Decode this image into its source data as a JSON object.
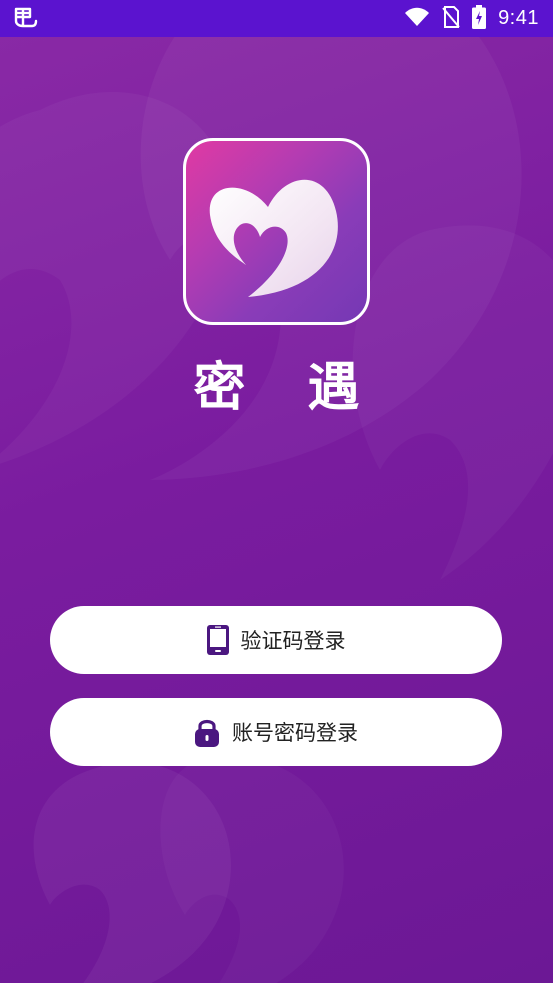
{
  "status_bar": {
    "time": "9:41",
    "left_icon": "bug-icon",
    "icons": [
      "wifi-icon",
      "no-sim-icon",
      "battery-charging-icon"
    ]
  },
  "app": {
    "name": "密 遇",
    "icon": "heart-logo-icon"
  },
  "buttons": {
    "sms_login": {
      "label": "验证码登录",
      "icon": "phone-icon"
    },
    "password_login": {
      "label": "账号密码登录",
      "icon": "lock-icon"
    }
  },
  "colors": {
    "status_bar": "#5b13cf",
    "background": "#7b1d9e",
    "icon_gradient_start": "#e03aa3",
    "icon_gradient_end": "#7538b4",
    "icon_accent": "#5a1a8a"
  }
}
